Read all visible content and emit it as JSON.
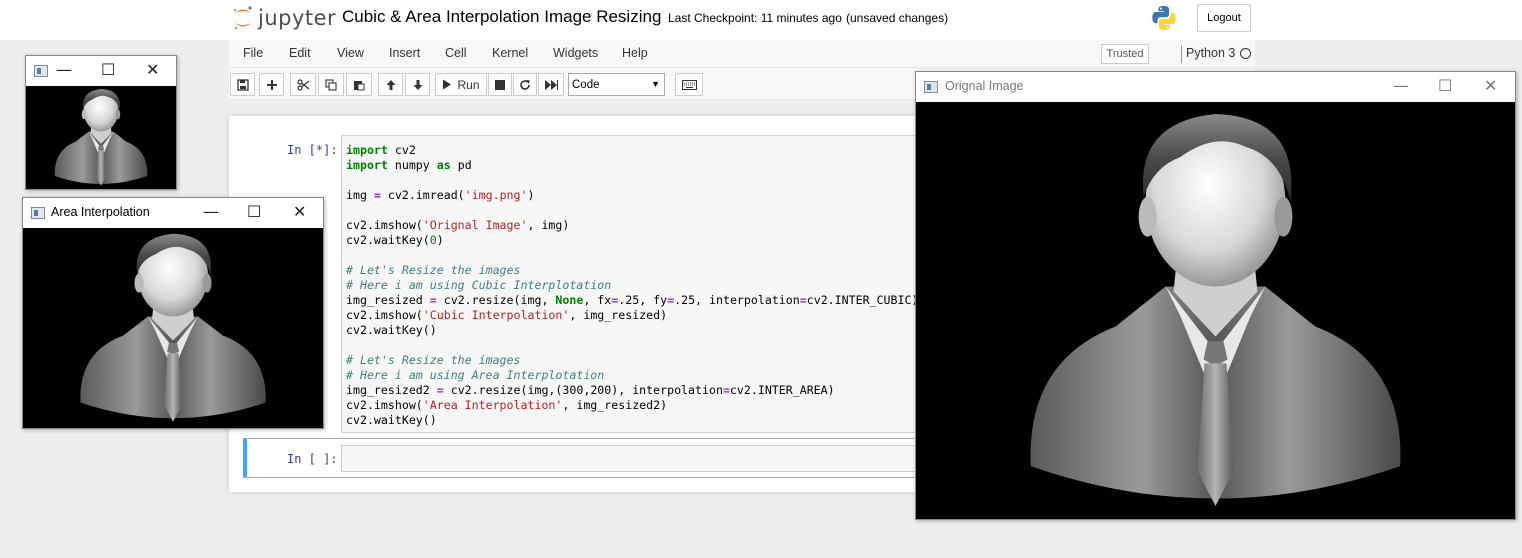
{
  "header": {
    "logo_text": "jupyter",
    "notebook_title": "Cubic & Area Interpolation Image Resizing",
    "checkpoint": "Last Checkpoint: 11 minutes ago",
    "unsaved": "(unsaved changes)",
    "logout_label": "Logout"
  },
  "menu": {
    "items": [
      "File",
      "Edit",
      "View",
      "Insert",
      "Cell",
      "Kernel",
      "Widgets",
      "Help"
    ],
    "trusted": "Trusted",
    "kernel": "Python 3"
  },
  "toolbar": {
    "run_label": "Run",
    "cell_type": "Code",
    "icons": [
      "save-icon",
      "plus-icon",
      "cut-icon",
      "copy-icon",
      "paste-icon",
      "arrow-up-icon",
      "arrow-down-icon",
      "run-icon",
      "stop-icon",
      "restart-icon",
      "fast-forward-icon",
      "keyboard-icon"
    ]
  },
  "cells": [
    {
      "prompt": "In [*]:",
      "code": [
        "import cv2",
        "import numpy as pd",
        "",
        "img = cv2.imread('img.png')",
        "",
        "cv2.imshow('Orignal Image', img)",
        "cv2.waitKey(0)",
        "",
        "# Let's Resize the images",
        "# Here i am using Cubic Interplotation",
        "img_resized = cv2.resize(img, None, fx=.25, fy=.25, interpolation=cv2.INTER_CUBIC)",
        "cv2.imshow('Cubic Interpolation', img_resized)",
        "cv2.waitKey()",
        "",
        "# Let's Resize the images",
        "# Here i am using Area Interplotation",
        "img_resized2 = cv2.resize(img,(300,200), interpolation=cv2.INTER_AREA)",
        "cv2.imshow('Area Interpolation', img_resized2)",
        "cv2.waitKey()"
      ]
    },
    {
      "prompt": "In [ ]:",
      "code": []
    }
  ],
  "windows": {
    "cubic": {
      "title": ""
    },
    "area": {
      "title": "Area Interpolation"
    },
    "original": {
      "title": "Orignal Image"
    }
  },
  "window_controls": {
    "minimize": "—",
    "maximize": "☐",
    "close": "✕"
  },
  "colors": {
    "cell_selected": "#42a5f5",
    "prompt": "#303f9f",
    "keyword": "#008000",
    "string": "#ba2121",
    "comment": "#408080"
  }
}
